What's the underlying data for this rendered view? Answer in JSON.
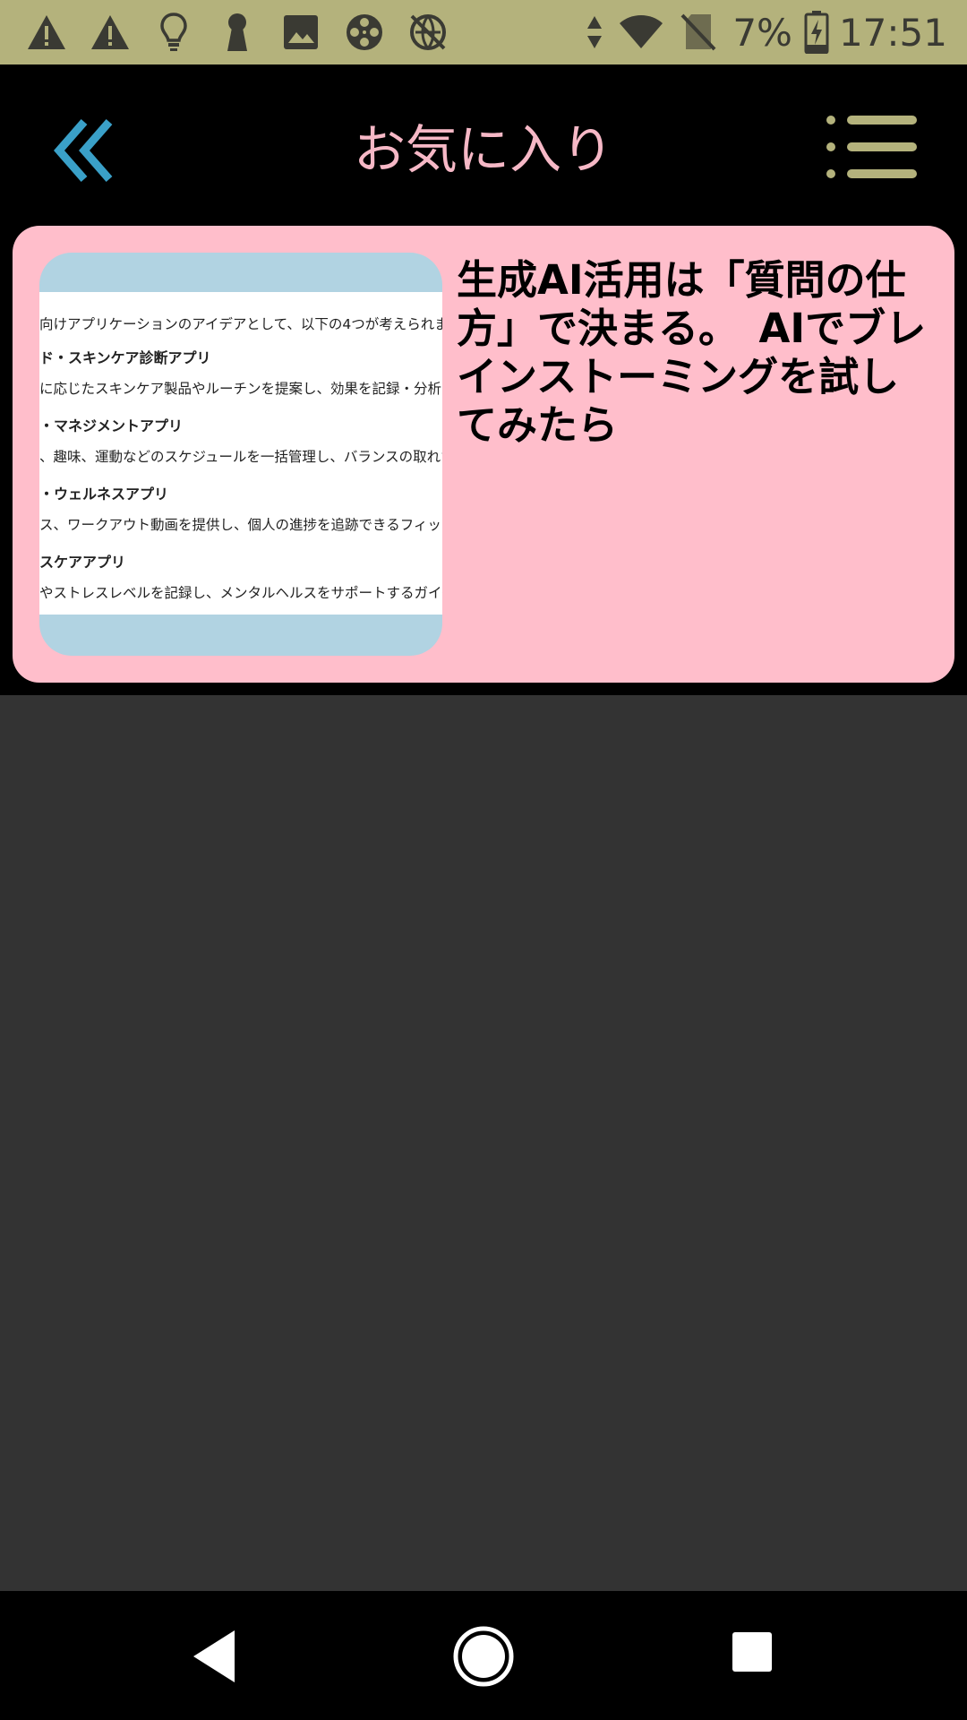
{
  "status_bar": {
    "icons_left": [
      "warning-icon",
      "warning-icon",
      "lightbulb-icon",
      "keyhole-icon",
      "image-icon",
      "film-reel-icon",
      "no-network-icon"
    ],
    "icons_right": [
      "data-arrows-icon",
      "wifi-icon",
      "no-sim-icon",
      "battery-charging-icon"
    ],
    "battery": "7%",
    "time": "17:51",
    "background_color": "#b4b27c"
  },
  "app_bar": {
    "title": "お気に入り",
    "back_icon": "double-chevron-left-icon",
    "menu_icon": "list-menu-icon",
    "title_color": "#f6b8c6",
    "back_color": "#3aa0c8",
    "menu_color": "#b4b27c"
  },
  "favorites": [
    {
      "title": "生成AI活用は「質問の仕方」で決まる。　AIでブレインストーミングを試してみたら",
      "thumbnail_lines": {
        "intro": "向けアプリケーションのアイデアとして、以下の4つが考えられます。",
        "items": [
          {
            "heading": "ド・スキンケア診断アプリ",
            "text": "に応じたスキンケア製品やルーチンを提案し、効果を記録・分析できるア"
          },
          {
            "heading": "・マネジメントアプリ",
            "text": "、趣味、運動などのスケジュールを一括管理し、バランスの取れた生活を"
          },
          {
            "heading": "・ウェルネスアプリ",
            "text": "ス、ワークアウト動画を提供し、個人の進捗を追跡できるフィットネスア"
          },
          {
            "heading": "スケアアプリ",
            "text": "やストレスレベルを記録し、メンタルヘルスをサポートするガイダンスやリラ"
          }
        ]
      },
      "card_color": "#ffbecb"
    }
  ],
  "nav_bar": {
    "back": "nav-back-icon",
    "home": "nav-home-icon",
    "recents": "nav-recents-icon"
  }
}
